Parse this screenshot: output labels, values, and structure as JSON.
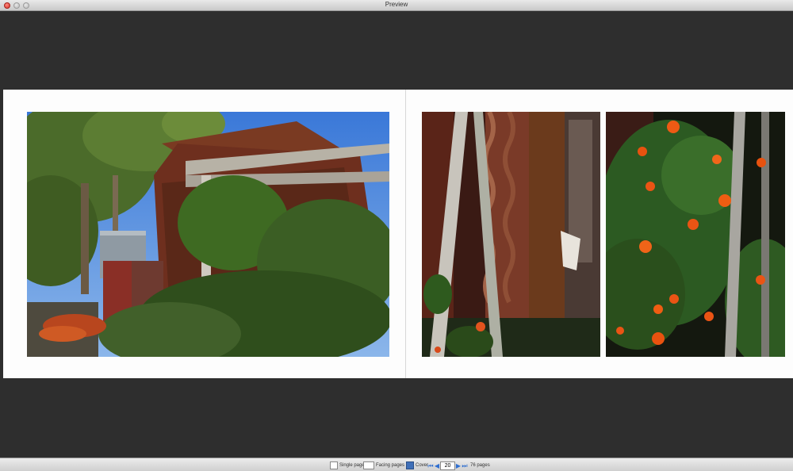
{
  "window": {
    "title": "Preview"
  },
  "toolbar": {
    "single_pages_label": "Single pages",
    "facing_pages_label": "Facing pages",
    "cover_label": "Cover",
    "current_page": "20",
    "total_pages_label": "76 pages"
  },
  "icons": {
    "close": "close-icon",
    "minimize": "minimize-icon",
    "zoom": "zoom-icon",
    "first_page": "first-page-icon",
    "prev_page": "prev-page-icon",
    "next_page": "next-page-icon",
    "last_page": "last-page-icon"
  },
  "colors": {
    "background": "#2e2e2e",
    "page": "#fdfdfd",
    "accent": "#2f6fd0"
  }
}
